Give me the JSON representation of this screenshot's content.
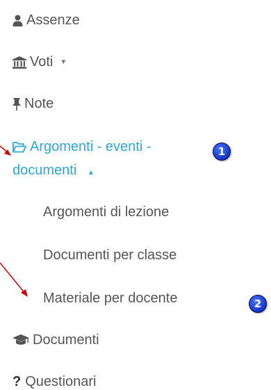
{
  "menu": {
    "items": [
      {
        "label": "Assenze",
        "icon": "user-icon"
      },
      {
        "label": "Voti",
        "icon": "bank-icon",
        "caret": "▼"
      },
      {
        "label": "Note",
        "icon": "pin-icon"
      },
      {
        "label_line1": "Argomenti - eventi -",
        "label_line2": "documenti",
        "icon": "folder-open-icon",
        "caret": "▲",
        "active": true
      },
      {
        "label": "Documenti",
        "icon": "graduation-cap-icon"
      },
      {
        "label": "Questionari",
        "icon": "question-icon",
        "icon_glyph": "?"
      }
    ],
    "submenu": [
      {
        "label": "Argomenti di lezione"
      },
      {
        "label": "Documenti per classe"
      },
      {
        "label": "Materiale per docente"
      }
    ]
  },
  "annotations": {
    "badge1": "1",
    "badge2": "2"
  },
  "colors": {
    "text": "#555555",
    "active": "#2ea7d8",
    "arrow": "#cc0000",
    "badge": "#1436c8"
  }
}
